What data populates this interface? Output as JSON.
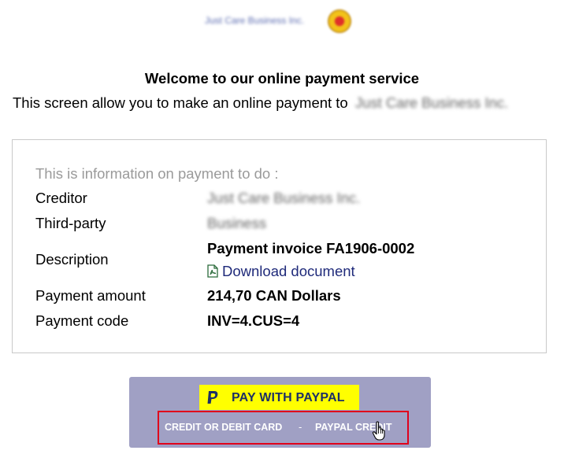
{
  "header": {
    "company_logo_text": "Just Care Business Inc."
  },
  "welcome": {
    "title": "Welcome to our online payment service",
    "subtitle": "This screen allow you to make an online payment to",
    "company_name": "Just Care Business Inc."
  },
  "payment_info": {
    "heading": "This is information on payment to do :",
    "rows": [
      {
        "label": "Creditor",
        "value": "Just Care Business Inc."
      },
      {
        "label": "Third-party",
        "value": "Business"
      },
      {
        "label": "Description",
        "value": "Payment invoice FA1906-0002",
        "link": "Download document"
      },
      {
        "label": "Payment amount",
        "value": "214,70 CAN Dollars"
      },
      {
        "label": "Payment code",
        "value": "INV=4.CUS=4"
      }
    ]
  },
  "payment_options": {
    "paypal_button": "PAY WITH PAYPAL",
    "credit_card_link": "CREDIT OR DEBIT CARD",
    "separator": "-",
    "paypal_credit_link": "PAYPAL CREDIT"
  },
  "icons": {
    "document": "pdf-icon",
    "paypal": "paypal-logo-icon",
    "cursor": "hand-pointer-icon"
  },
  "colors": {
    "panel_bg": "#a0a0c4",
    "paypal_button_bg": "#ffff00",
    "highlight_border": "#e0001b",
    "link": "#1f2a7a",
    "heading_gray": "#9a9a9a"
  }
}
